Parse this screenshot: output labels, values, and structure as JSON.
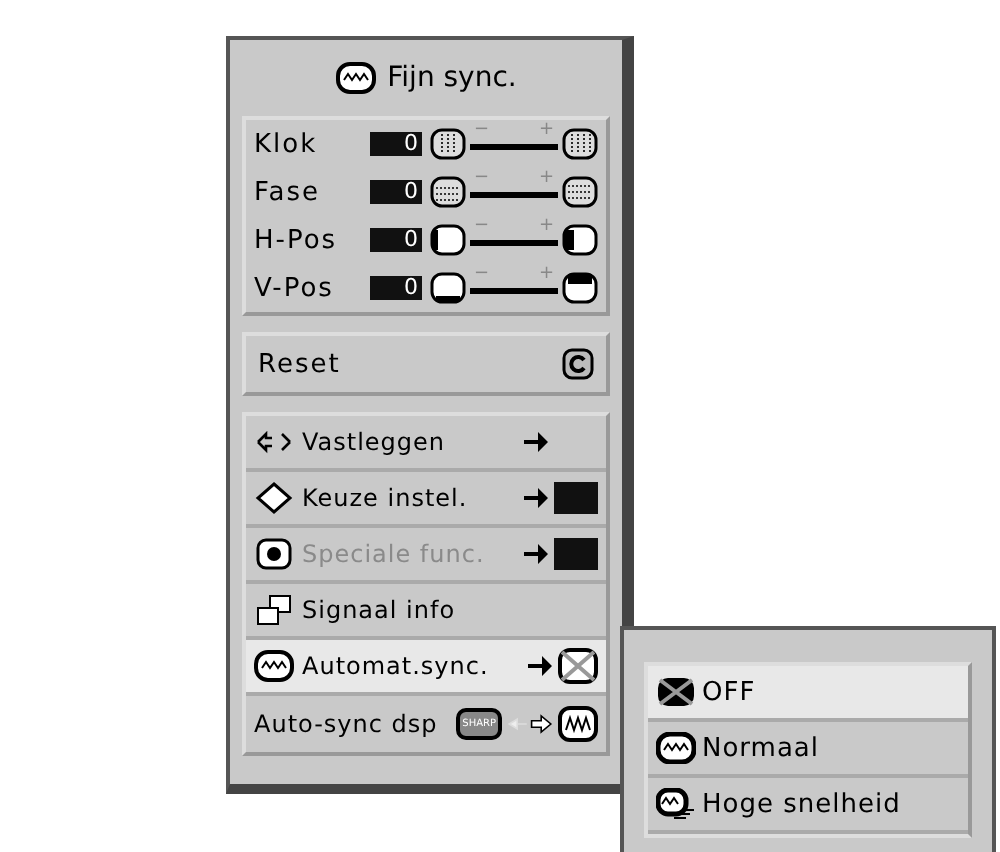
{
  "menu": {
    "title": "Fijn sync.",
    "adjustments": [
      {
        "label": "Klok",
        "value": "0",
        "minus": "−",
        "plus": "+"
      },
      {
        "label": "Fase",
        "value": "0",
        "minus": "−",
        "plus": "+"
      },
      {
        "label": "H-Pos",
        "value": "0",
        "minus": "−",
        "plus": "+"
      },
      {
        "label": "V-Pos",
        "value": "0",
        "minus": "−",
        "plus": "+"
      }
    ],
    "reset": {
      "label": "Reset"
    },
    "items": [
      {
        "label": "Vastleggen",
        "kind": "arrow",
        "selected": false,
        "disabled": false
      },
      {
        "label": "Keuze instel.",
        "kind": "arrow-box",
        "selected": false,
        "disabled": false
      },
      {
        "label": "Speciale func.",
        "kind": "arrow-box",
        "selected": false,
        "disabled": true
      },
      {
        "label": "Signaal info",
        "kind": "none",
        "selected": false,
        "disabled": false
      },
      {
        "label": "Automat.sync.",
        "kind": "arrow-sync",
        "selected": true,
        "disabled": false
      },
      {
        "label": "Auto-sync dsp",
        "kind": "toggle",
        "badge": "SHARP",
        "selected": false,
        "disabled": false
      }
    ]
  },
  "submenu": {
    "options": [
      {
        "label": "OFF",
        "selected": true
      },
      {
        "label": "Normaal",
        "selected": false
      },
      {
        "label": "Hoge snelheid",
        "selected": false
      }
    ]
  }
}
